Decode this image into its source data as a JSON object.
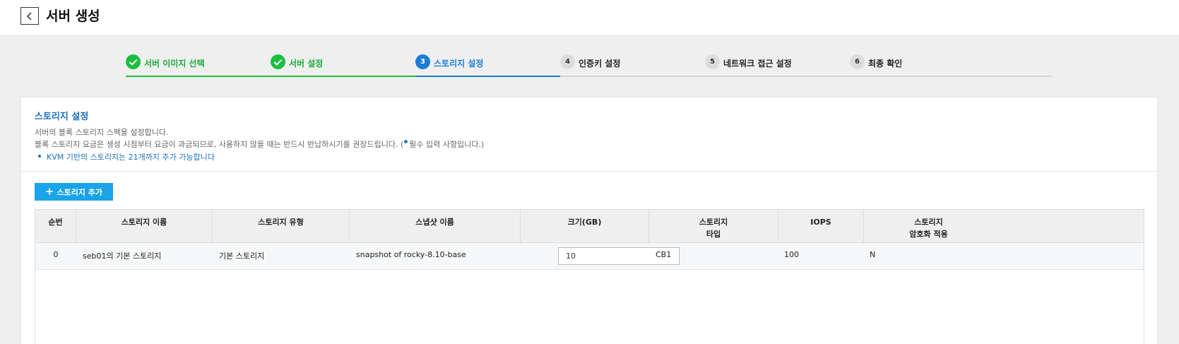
{
  "header": {
    "title": "서버 생성",
    "back_icon": "chevron-left-icon"
  },
  "stepper": {
    "steps": [
      {
        "number": "1",
        "label": "서버 이미지 선택",
        "state": "done"
      },
      {
        "number": "2",
        "label": "서버 설정",
        "state": "done"
      },
      {
        "number": "3",
        "label": "스토리지 설정",
        "state": "active"
      },
      {
        "number": "4",
        "label": "인증키 설정",
        "state": "pending"
      },
      {
        "number": "5",
        "label": "네트워크 접근 설정",
        "state": "pending"
      },
      {
        "number": "6",
        "label": "최종 확인",
        "state": "pending"
      }
    ]
  },
  "section": {
    "title": "스토리지 설정",
    "desc1": "서버의 블록 스토리지 스펙을 설정합니다.",
    "desc2_before": "블록 스토리지 요금은 생성 시점부터 요금이 과금되므로, 사용하지 않을 때는 반드시 반납하시기를 권장드립니다. (",
    "desc2_after": "필수 입력 사항입니다.)",
    "note": "KVM 기반의 스토리지는 21개까지 추가 가능합니다"
  },
  "add_button": {
    "label": "스토리지 추가"
  },
  "table": {
    "headers": [
      "순번",
      "스토리지 이름",
      "스토리지 유형",
      "스냅샷 이름",
      "크기(GB)",
      "스토리지\n타입",
      "IOPS",
      "스토리지\n암호화 적용"
    ],
    "rows": [
      {
        "index": "0",
        "name": "seb01의 기본 스토리지",
        "type": "기본 스토리지",
        "snapshot": "snapshot of rocky-8.10-base",
        "size": "10",
        "storage_type": "CB1",
        "iops": "100",
        "encryption": "N"
      }
    ]
  },
  "colors": {
    "done": "#1bbf3f",
    "active": "#1c7dd6",
    "button": "#1aa3e8"
  }
}
